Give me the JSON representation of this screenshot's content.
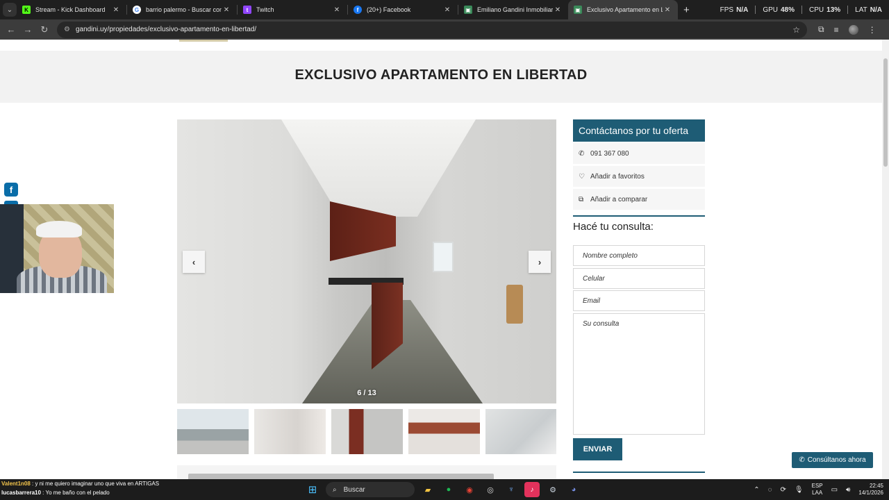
{
  "browser": {
    "tabs": [
      {
        "title": "Stream - Kick Dashboard",
        "icon": "kick-icon",
        "color": "#53fc18"
      },
      {
        "title": "barrio palermo - Buscar con Go",
        "icon": "google-icon",
        "color": "#4285f4"
      },
      {
        "title": "Twitch",
        "icon": "twitch-icon",
        "color": "#9146ff"
      },
      {
        "title": "(20+) Facebook",
        "icon": "facebook-icon",
        "color": "#1877f2"
      },
      {
        "title": "Emiliano Gandini Inmobiliaria -",
        "icon": "site-icon",
        "color": "#3b8a5a"
      },
      {
        "title": "Exclusivo Apartamento en Liber",
        "icon": "site-icon",
        "color": "#3b8a5a"
      }
    ],
    "active_tab": 5,
    "new_tab": "+",
    "perf": {
      "fps_label": "FPS",
      "fps_value": "N/A",
      "gpu_label": "GPU",
      "gpu_value": "48%",
      "cpu_label": "CPU",
      "cpu_value": "13%",
      "lat_label": "LAT",
      "lat_value": "N/A"
    },
    "url": "gandini.uy/propiedades/exclusivo-apartamento-en-libertad/"
  },
  "page": {
    "title": "EXCLUSIVO APARTAMENTO EN LIBERTAD",
    "gallery": {
      "counter": "6 / 13",
      "prev": "‹",
      "next": "›"
    },
    "sidebar": {
      "contact_title": "Contáctanos por tu oferta",
      "phone": "091 367 080",
      "favorites": "Añadir a favoritos",
      "compare": "Añadir a comparar",
      "form_title": "Hacé tu consulta:",
      "name_placeholder": "Nombre completo",
      "phone_placeholder": "Celular",
      "email_placeholder": "Email",
      "message_placeholder": "Su consulta",
      "submit": "ENVIAR"
    },
    "whatsapp_button": "Consúltanos ahora",
    "share": {
      "facebook_icon": "f"
    }
  },
  "chat": [
    {
      "user": "Valent1n08",
      "message": ": y ni me quiero imaginar uno que viva en ARTIGAS"
    },
    {
      "user": "lucasbarrera10",
      "message": ": Yo me baño con el pelado"
    }
  ],
  "taskbar": {
    "search": "Buscar",
    "lang_top": "ESP",
    "lang_bottom": "LAA",
    "time": "22:45",
    "date": "14/1/2026"
  }
}
